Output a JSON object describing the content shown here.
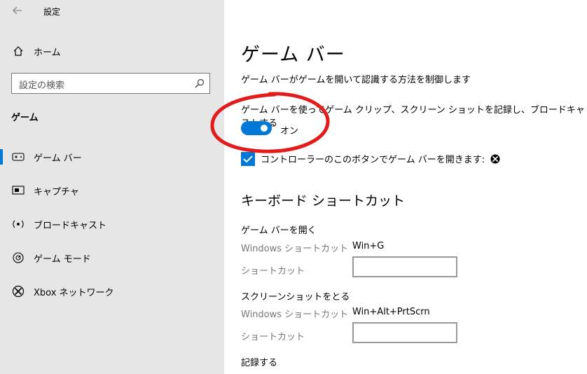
{
  "app": {
    "title": "設定"
  },
  "sidebar": {
    "home": "ホーム",
    "search_placeholder": "設定の検索",
    "section": "ゲーム",
    "items": [
      {
        "label": "ゲーム バー",
        "icon": "game-bar-icon"
      },
      {
        "label": "キャプチャ",
        "icon": "capture-icon"
      },
      {
        "label": "ブロードキャスト",
        "icon": "broadcast-icon"
      },
      {
        "label": "ゲーム モード",
        "icon": "game-mode-icon"
      },
      {
        "label": "Xbox ネットワーク",
        "icon": "xbox-icon"
      }
    ]
  },
  "main": {
    "title": "ゲーム バー",
    "description": "ゲーム バーがゲームを開いて認識する方法を制御します",
    "toggle_desc": "ゲーム バーを使ってゲーム クリップ、スクリーン ショットを記録し、ブロードキャストする",
    "toggle_state": "オン",
    "toggle_on": true,
    "checkbox_label": "コントローラーのこのボタンでゲーム バーを開きます:",
    "checkbox_checked": true,
    "shortcuts_title": "キーボード ショートカット",
    "shortcuts": [
      {
        "title": "ゲーム バーを開く",
        "win_label": "Windows ショートカット",
        "win_value": "Win+G",
        "custom_label": "ショートカット",
        "custom_value": ""
      },
      {
        "title": "スクリーンショットをとる",
        "win_label": "Windows ショートカット",
        "win_value": "Win+Alt+PrtScrn",
        "custom_label": "ショートカット",
        "custom_value": ""
      }
    ],
    "record_title": "記録する"
  },
  "colors": {
    "accent": "#0078d7",
    "annotation": "#e31b1b",
    "sidebar_bg": "#e6e6e6"
  }
}
